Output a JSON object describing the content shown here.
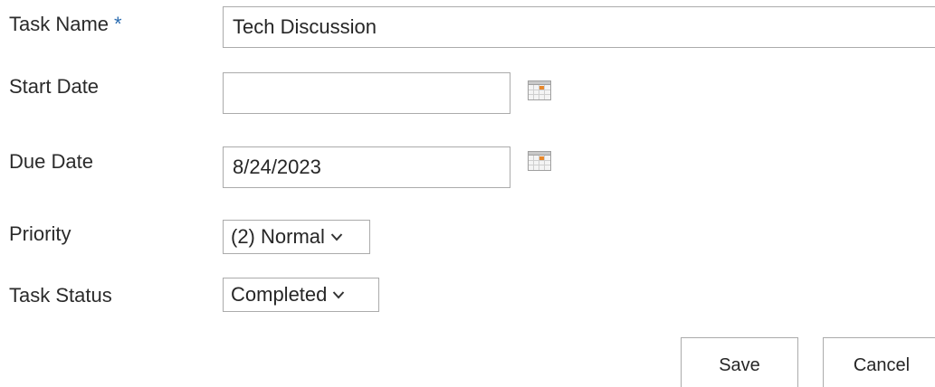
{
  "form": {
    "task_name": {
      "label": "Task Name",
      "required_marker": "*",
      "value": "Tech Discussion"
    },
    "start_date": {
      "label": "Start Date",
      "value": ""
    },
    "due_date": {
      "label": "Due Date",
      "value": "8/24/2023"
    },
    "priority": {
      "label": "Priority",
      "selected": "(2) Normal"
    },
    "task_status": {
      "label": "Task Status",
      "selected": "Completed"
    }
  },
  "actions": {
    "save_label": "Save",
    "cancel_label": "Cancel"
  },
  "icons": {
    "date_picker": "calendar-icon",
    "dropdown": "chevron-down-icon"
  },
  "colors": {
    "required_star": "#2b6cb0",
    "calendar_accent": "#e8872a"
  }
}
